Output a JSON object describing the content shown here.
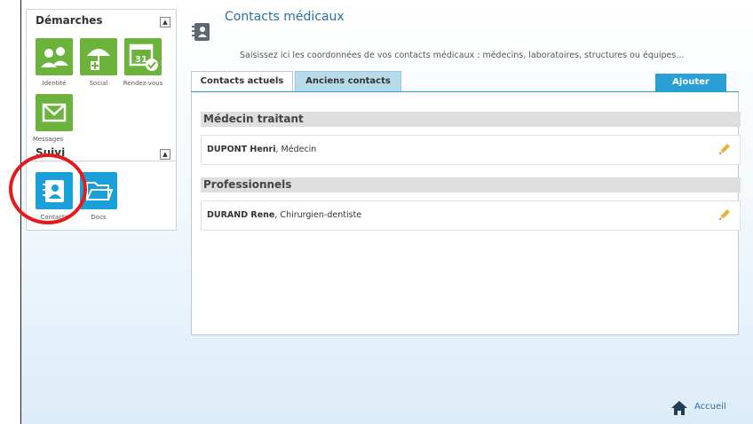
{
  "sidebar": {
    "demarches": {
      "title": "Démarches",
      "items": [
        {
          "label": "Identité",
          "icon": "people-icon"
        },
        {
          "label": "Social",
          "icon": "umbrella-plus-icon"
        },
        {
          "label": "Rendez-vous",
          "icon": "calendar-check-icon"
        },
        {
          "label": "Messages",
          "icon": "envelope-icon"
        }
      ],
      "calendar_day": "31"
    },
    "suivi": {
      "title": "Suivi",
      "items": [
        {
          "label": "Contacts",
          "icon": "address-book-icon"
        },
        {
          "label": "Docs",
          "icon": "folder-icon"
        }
      ]
    }
  },
  "main": {
    "title": "Contacts médicaux",
    "subtitle": "Saisissez ici les coordonnées de vos contacts médicaux : médecins, laboratoires, structures ou équipes...",
    "tabs": [
      {
        "label": "Contacts actuels",
        "active": true
      },
      {
        "label": "Anciens contacts",
        "active": false
      }
    ],
    "add_label": "Ajouter",
    "groups": [
      {
        "title": "Médecin traitant",
        "contacts": [
          {
            "name": "DUPONT Henri",
            "role": ", Médecin"
          }
        ]
      },
      {
        "title": "Professionnels",
        "contacts": [
          {
            "name": "DURAND Rene",
            "role": ", Chirurgien-dentiste"
          }
        ]
      }
    ]
  },
  "footer": {
    "home_label": "Accueil"
  },
  "colors": {
    "green_tile": "#6cb33e",
    "blue_tile": "#1aa0d8",
    "accent": "#2a9fd6",
    "title": "#2a6fa8",
    "highlight_circle": "#e51b1b"
  }
}
